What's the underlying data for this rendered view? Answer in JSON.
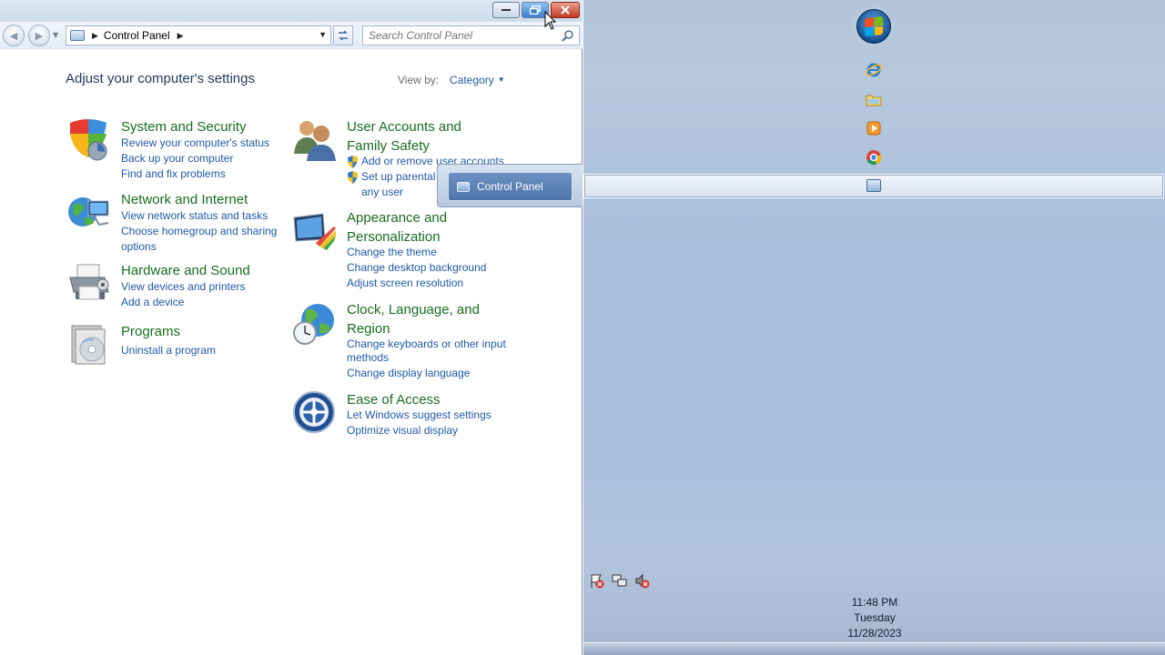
{
  "window": {
    "titlebar": {
      "minimize": "minimize",
      "maximize": "restore",
      "close": "close"
    },
    "address": {
      "crumbs": [
        "Control Panel"
      ]
    },
    "search": {
      "placeholder": "Search Control Panel"
    }
  },
  "content": {
    "heading": "Adjust your computer's settings",
    "view_by_label": "View by:",
    "view_by_value": "Category",
    "categories": [
      {
        "title": "System and Security",
        "icon": "shield-icon",
        "links": [
          "Review your computer's status",
          "Back up your computer",
          "Find and fix problems"
        ]
      },
      {
        "title": "Network and Internet",
        "icon": "network-globe-icon",
        "links": [
          "View network status and tasks",
          "Choose homegroup and sharing options"
        ]
      },
      {
        "title": "Hardware and Sound",
        "icon": "printer-icon",
        "links": [
          "View devices and printers",
          "Add a device"
        ]
      },
      {
        "title": "Programs",
        "icon": "programs-disc-icon",
        "links": [
          "Uninstall a program"
        ]
      },
      {
        "title": "User Accounts and Family Safety",
        "icon": "users-icon",
        "links": [
          "Add or remove user accounts",
          "Set up parental controls for any user"
        ]
      },
      {
        "title": "Appearance and Personalization",
        "icon": "monitor-paint-icon",
        "links": [
          "Change the theme",
          "Change desktop background",
          "Adjust screen resolution"
        ]
      },
      {
        "title": "Clock, Language, and Region",
        "icon": "globe-clock-icon",
        "links": [
          "Change keyboards or other input methods",
          "Change display language"
        ]
      },
      {
        "title": "Ease of Access",
        "icon": "ease-of-access-icon",
        "links": [
          "Let Windows suggest settings",
          "Optimize visual display"
        ]
      }
    ],
    "visible_text": {
      "ua_link1_visible": "Add or remove user accounts",
      "ua_link2_line1": "Set up parental",
      "ua_link2_line2": "any user",
      "net_link2_line1": "Choose homegroup and sharing",
      "net_link2_line2": "options",
      "ua_title_line1": "User Accounts and",
      "ua_title_line2": "Family Safety",
      "ap_title_line1": "Appearance and",
      "ap_title_line2": "Personalization",
      "cl_title_line1": "Clock, Language, and",
      "cl_title_line2": "Region",
      "cl_link1_line1": "Change keyboards or other input",
      "cl_link1_line2": "methods"
    }
  },
  "popup": {
    "label": "Control Panel"
  },
  "taskbar": {
    "pinned": [
      "internet-explorer-icon",
      "windows-explorer-icon",
      "media-player-icon",
      "chrome-icon",
      "control-panel-icon"
    ],
    "tray_icons": [
      "action-center-icon",
      "network-icon",
      "volume-muted-icon"
    ],
    "clock": {
      "time": "11:48 PM",
      "day": "Tuesday",
      "date": "11/28/2023"
    }
  },
  "colors": {
    "link": "#1e5aa8",
    "category_title": "#176e1d",
    "heading": "#1e395b"
  }
}
